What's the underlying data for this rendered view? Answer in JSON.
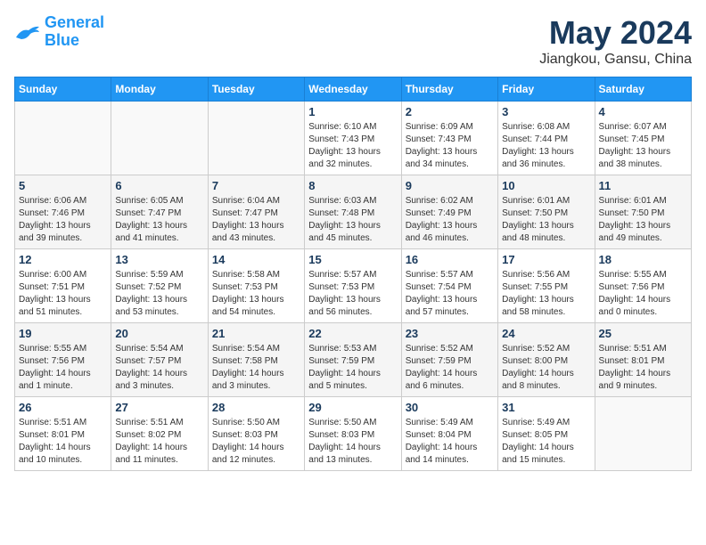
{
  "header": {
    "logo_line1": "General",
    "logo_line2": "Blue",
    "month": "May 2024",
    "location": "Jiangkou, Gansu, China"
  },
  "weekdays": [
    "Sunday",
    "Monday",
    "Tuesday",
    "Wednesday",
    "Thursday",
    "Friday",
    "Saturday"
  ],
  "weeks": [
    [
      {
        "day": "",
        "info": ""
      },
      {
        "day": "",
        "info": ""
      },
      {
        "day": "",
        "info": ""
      },
      {
        "day": "1",
        "info": "Sunrise: 6:10 AM\nSunset: 7:43 PM\nDaylight: 13 hours\nand 32 minutes."
      },
      {
        "day": "2",
        "info": "Sunrise: 6:09 AM\nSunset: 7:43 PM\nDaylight: 13 hours\nand 34 minutes."
      },
      {
        "day": "3",
        "info": "Sunrise: 6:08 AM\nSunset: 7:44 PM\nDaylight: 13 hours\nand 36 minutes."
      },
      {
        "day": "4",
        "info": "Sunrise: 6:07 AM\nSunset: 7:45 PM\nDaylight: 13 hours\nand 38 minutes."
      }
    ],
    [
      {
        "day": "5",
        "info": "Sunrise: 6:06 AM\nSunset: 7:46 PM\nDaylight: 13 hours\nand 39 minutes."
      },
      {
        "day": "6",
        "info": "Sunrise: 6:05 AM\nSunset: 7:47 PM\nDaylight: 13 hours\nand 41 minutes."
      },
      {
        "day": "7",
        "info": "Sunrise: 6:04 AM\nSunset: 7:47 PM\nDaylight: 13 hours\nand 43 minutes."
      },
      {
        "day": "8",
        "info": "Sunrise: 6:03 AM\nSunset: 7:48 PM\nDaylight: 13 hours\nand 45 minutes."
      },
      {
        "day": "9",
        "info": "Sunrise: 6:02 AM\nSunset: 7:49 PM\nDaylight: 13 hours\nand 46 minutes."
      },
      {
        "day": "10",
        "info": "Sunrise: 6:01 AM\nSunset: 7:50 PM\nDaylight: 13 hours\nand 48 minutes."
      },
      {
        "day": "11",
        "info": "Sunrise: 6:01 AM\nSunset: 7:50 PM\nDaylight: 13 hours\nand 49 minutes."
      }
    ],
    [
      {
        "day": "12",
        "info": "Sunrise: 6:00 AM\nSunset: 7:51 PM\nDaylight: 13 hours\nand 51 minutes."
      },
      {
        "day": "13",
        "info": "Sunrise: 5:59 AM\nSunset: 7:52 PM\nDaylight: 13 hours\nand 53 minutes."
      },
      {
        "day": "14",
        "info": "Sunrise: 5:58 AM\nSunset: 7:53 PM\nDaylight: 13 hours\nand 54 minutes."
      },
      {
        "day": "15",
        "info": "Sunrise: 5:57 AM\nSunset: 7:53 PM\nDaylight: 13 hours\nand 56 minutes."
      },
      {
        "day": "16",
        "info": "Sunrise: 5:57 AM\nSunset: 7:54 PM\nDaylight: 13 hours\nand 57 minutes."
      },
      {
        "day": "17",
        "info": "Sunrise: 5:56 AM\nSunset: 7:55 PM\nDaylight: 13 hours\nand 58 minutes."
      },
      {
        "day": "18",
        "info": "Sunrise: 5:55 AM\nSunset: 7:56 PM\nDaylight: 14 hours\nand 0 minutes."
      }
    ],
    [
      {
        "day": "19",
        "info": "Sunrise: 5:55 AM\nSunset: 7:56 PM\nDaylight: 14 hours\nand 1 minute."
      },
      {
        "day": "20",
        "info": "Sunrise: 5:54 AM\nSunset: 7:57 PM\nDaylight: 14 hours\nand 3 minutes."
      },
      {
        "day": "21",
        "info": "Sunrise: 5:54 AM\nSunset: 7:58 PM\nDaylight: 14 hours\nand 3 minutes."
      },
      {
        "day": "22",
        "info": "Sunrise: 5:53 AM\nSunset: 7:59 PM\nDaylight: 14 hours\nand 5 minutes."
      },
      {
        "day": "23",
        "info": "Sunrise: 5:52 AM\nSunset: 7:59 PM\nDaylight: 14 hours\nand 6 minutes."
      },
      {
        "day": "24",
        "info": "Sunrise: 5:52 AM\nSunset: 8:00 PM\nDaylight: 14 hours\nand 8 minutes."
      },
      {
        "day": "25",
        "info": "Sunrise: 5:51 AM\nSunset: 8:01 PM\nDaylight: 14 hours\nand 9 minutes."
      }
    ],
    [
      {
        "day": "26",
        "info": "Sunrise: 5:51 AM\nSunset: 8:01 PM\nDaylight: 14 hours\nand 10 minutes."
      },
      {
        "day": "27",
        "info": "Sunrise: 5:51 AM\nSunset: 8:02 PM\nDaylight: 14 hours\nand 11 minutes."
      },
      {
        "day": "28",
        "info": "Sunrise: 5:50 AM\nSunset: 8:03 PM\nDaylight: 14 hours\nand 12 minutes."
      },
      {
        "day": "29",
        "info": "Sunrise: 5:50 AM\nSunset: 8:03 PM\nDaylight: 14 hours\nand 13 minutes."
      },
      {
        "day": "30",
        "info": "Sunrise: 5:49 AM\nSunset: 8:04 PM\nDaylight: 14 hours\nand 14 minutes."
      },
      {
        "day": "31",
        "info": "Sunrise: 5:49 AM\nSunset: 8:05 PM\nDaylight: 14 hours\nand 15 minutes."
      },
      {
        "day": "",
        "info": ""
      }
    ]
  ]
}
